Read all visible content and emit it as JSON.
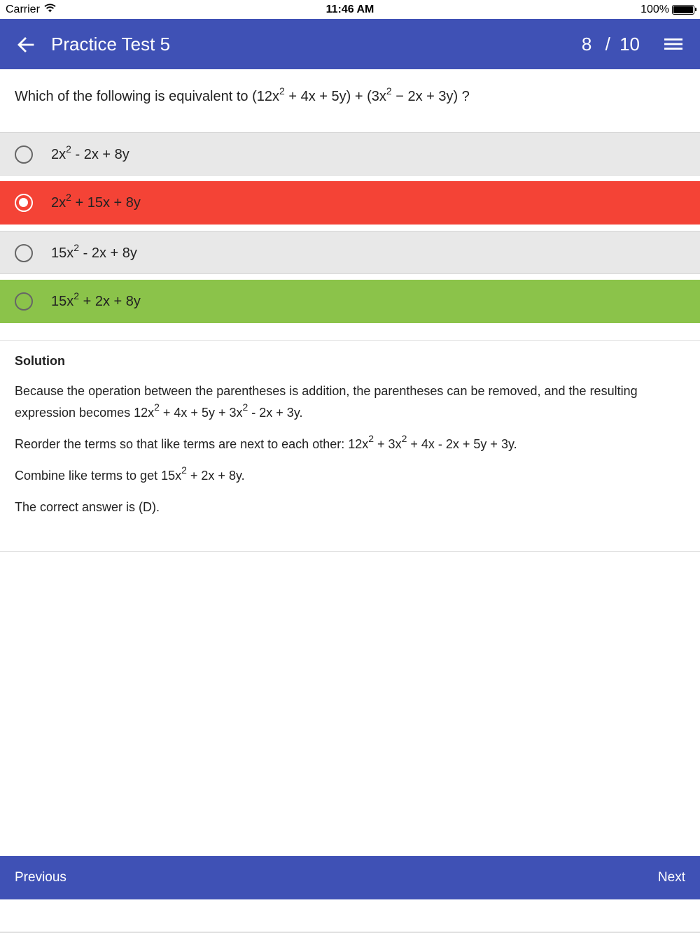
{
  "status_bar": {
    "carrier": "Carrier",
    "time": "11:46 AM",
    "battery": "100%"
  },
  "app_bar": {
    "title": "Practice Test 5",
    "current": "8",
    "separator": "/",
    "total": "10"
  },
  "question": {
    "p1": "Which of the following is equivalent to (12x",
    "exp1": "2",
    "p2": " + 4x + 5y) + (3x",
    "exp2": "2",
    "p3": " − 2x + 3y) ?"
  },
  "options": [
    {
      "pre": "2x",
      "exp": "2",
      "post": " - 2x + 8y",
      "state": "default"
    },
    {
      "pre": "2x",
      "exp": "2",
      "post": " + 15x + 8y",
      "state": "selected-incorrect"
    },
    {
      "pre": "15x",
      "exp": "2",
      "post": " - 2x + 8y",
      "state": "default"
    },
    {
      "pre": "15x",
      "exp": "2",
      "post": " + 2x + 8y",
      "state": "correct"
    }
  ],
  "solution": {
    "title": "Solution",
    "para1": {
      "a": "Because the operation between the parentheses is addition, the parentheses can be removed, and the resulting expression becomes 12x",
      "e1": "2",
      "b": " + 4x + 5y + 3x",
      "e2": "2",
      "c": " - 2x + 3y."
    },
    "para2": {
      "a": "Reorder the terms so that like terms are next to each other: 12x",
      "e1": "2",
      "b": " + 3x",
      "e2": "2",
      "c": " + 4x - 2x + 5y + 3y."
    },
    "para3": {
      "a": "Combine like terms to get 15x",
      "e1": "2",
      "b": " + 2x + 8y."
    },
    "para4": "The correct answer is (D)."
  },
  "bottom_nav": {
    "previous": "Previous",
    "next": "Next"
  },
  "colors": {
    "primary": "#3f51b5",
    "incorrect": "#f44336",
    "correct": "#8bc34a",
    "neutral_option": "#e8e8e8"
  },
  "icons": {
    "back": "arrow-left-icon",
    "menu": "hamburger-menu-icon",
    "wifi": "wifi-icon",
    "battery": "battery-icon"
  }
}
